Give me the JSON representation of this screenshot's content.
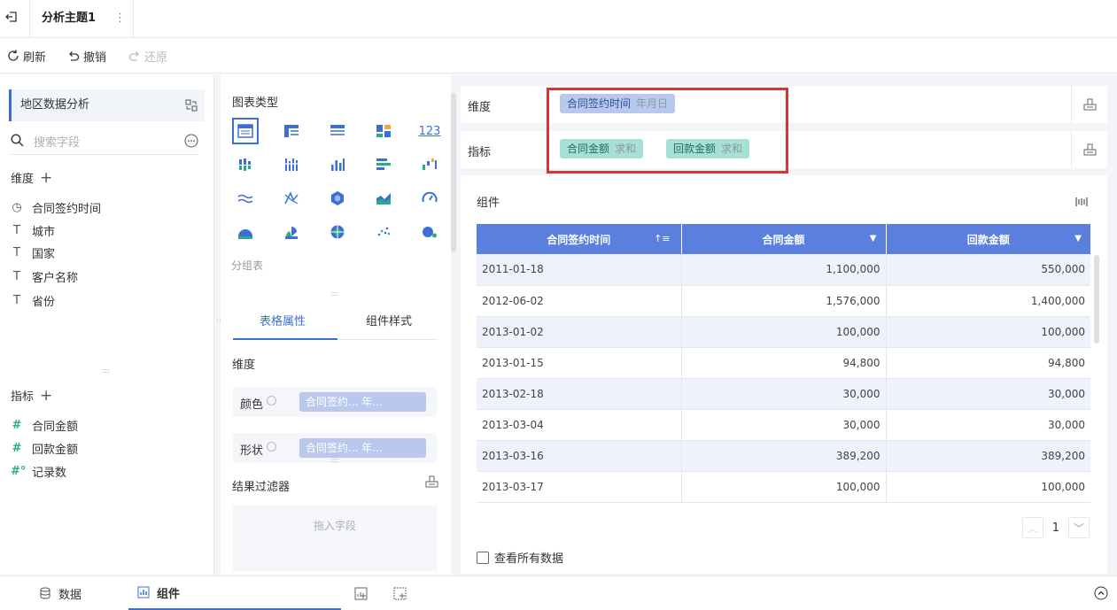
{
  "header": {
    "tab_title": "分析主题1",
    "tab_more": "⋮"
  },
  "toolbar": {
    "refresh_label": "刷新",
    "undo_label": "撤销",
    "redo_label": "还原"
  },
  "data_panel": {
    "dataset_name": "地区数据分析",
    "search_placeholder": "搜索字段",
    "dimensions_title": "维度",
    "dimensions": [
      {
        "icon": "clock-icon",
        "label": "合同签约时间"
      },
      {
        "icon": "text-type-icon",
        "label": "城市"
      },
      {
        "icon": "text-type-icon",
        "label": "国家"
      },
      {
        "icon": "text-type-icon",
        "label": "客户名称"
      },
      {
        "icon": "text-type-icon",
        "label": "省份"
      }
    ],
    "measures_title": "指标",
    "measures": [
      {
        "icon": "number-type-icon",
        "label": "合同金额"
      },
      {
        "icon": "number-type-icon",
        "label": "回款金额"
      },
      {
        "icon": "count-type-icon",
        "label": "记录数"
      }
    ]
  },
  "config_panel": {
    "chart_type_title": "图表类型",
    "chart_types_text": "123",
    "group_table_label": "分组表",
    "tabs": [
      "表格属性",
      "组件样式"
    ],
    "active_tab": 0,
    "dimension_label": "维度",
    "color_label": "颜色",
    "color_value": "合同签约...  年...",
    "shape_label": "形状",
    "shape_value": "合同签约...  年...",
    "filter_label": "结果过滤器",
    "filter_placeholder": "拖入字段"
  },
  "drop_rows": {
    "dimension_label": "维度",
    "dimension_chip": {
      "name": "合同签约时间",
      "agg": "年月日"
    },
    "measure_label": "指标",
    "measure_chips": [
      {
        "name": "合同金额",
        "agg": "求和"
      },
      {
        "name": "回款金额",
        "agg": "求和"
      }
    ]
  },
  "widget": {
    "title": "组件",
    "columns": [
      "合同签约时间",
      "合同金额",
      "回款金额"
    ],
    "sort_icon": "↑≡",
    "dropdown_arrow": "▼",
    "rows": [
      [
        "2011-01-18",
        "1,100,000",
        "550,000"
      ],
      [
        "2012-06-02",
        "1,576,000",
        "1,400,000"
      ],
      [
        "2013-01-02",
        "100,000",
        "100,000"
      ],
      [
        "2013-01-15",
        "94,800",
        "94,800"
      ],
      [
        "2013-02-18",
        "30,000",
        "30,000"
      ],
      [
        "2013-03-04",
        "30,000",
        "30,000"
      ],
      [
        "2013-03-16",
        "389,200",
        "389,200"
      ],
      [
        "2013-03-17",
        "100,000",
        "100,000"
      ]
    ],
    "page_number": "1",
    "view_all_label": "查看所有数据"
  },
  "bottom_bar": {
    "data_tab": "数据",
    "widget_tab": "组件"
  },
  "colors": {
    "accent": "#3b6fd4",
    "header_blue": "#5a7fdc",
    "dimension_chip": "#b9c9ee",
    "measure_chip": "#a7e0d5",
    "highlight_red": "#e03131"
  }
}
